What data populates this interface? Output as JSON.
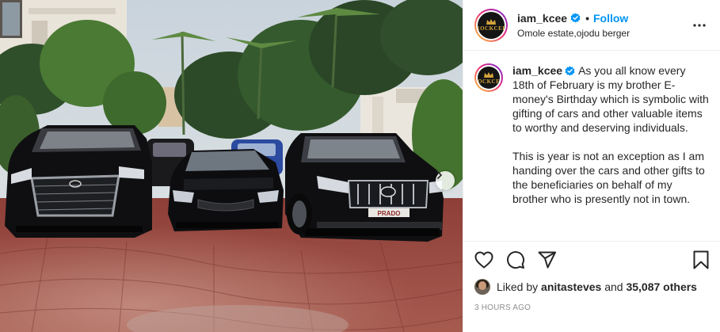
{
  "post": {
    "username": "iam_kcee",
    "follow_label": "Follow",
    "separator": "•",
    "location": "Omole estate,ojodu berger",
    "avatar_text": "ROCKCEE",
    "caption_para1": "As you all know every 18th of February is my brother E-money's Birthday which is symbolic with gifting of cars and other valuable items to worthy and deserving individuals.",
    "caption_para2": "This is year is not an exception as I am handing over the cars and other gifts to the beneficiaries on behalf of my brother who is presently not in town.",
    "likes_prefix": "Liked by",
    "liked_by_user": "anitasteves",
    "likes_conjunction": "and",
    "likes_count": "35,087 others",
    "timestamp": "3 HOURS AGO",
    "plate_text": "PRADO"
  },
  "icons": {
    "verified": "verified-badge-icon",
    "more": "more-options-icon",
    "like": "heart-icon",
    "comment": "comment-icon",
    "share": "share-icon",
    "save": "bookmark-icon",
    "next": "chevron-right-icon"
  },
  "colors": {
    "accent": "#0095f6",
    "text": "#262626",
    "secondary": "#8e8e8e",
    "border": "#efefef"
  }
}
